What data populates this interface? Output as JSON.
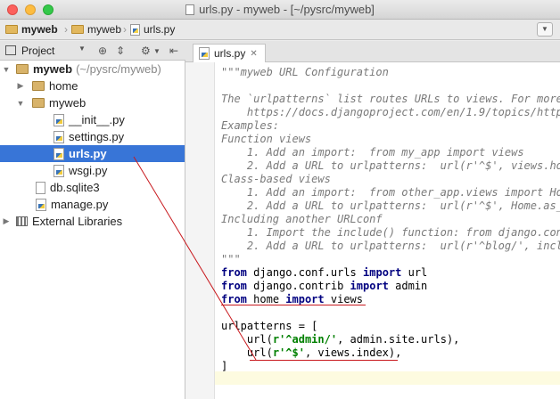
{
  "window": {
    "title": "urls.py - myweb - [~/pysrc/myweb]"
  },
  "breadcrumb": [
    "myweb",
    "myweb",
    "urls.py"
  ],
  "project_panel": {
    "label": "Project",
    "tree": [
      {
        "label": "myweb",
        "hint": "(~/pysrc/myweb)",
        "type": "folder",
        "expanded": true,
        "indent": 0
      },
      {
        "label": "home",
        "type": "folder",
        "expanded": false,
        "indent": 1
      },
      {
        "label": "myweb",
        "type": "folder",
        "expanded": true,
        "indent": 1
      },
      {
        "label": "__init__.py",
        "type": "py",
        "indent": 2
      },
      {
        "label": "settings.py",
        "type": "py",
        "indent": 2
      },
      {
        "label": "urls.py",
        "type": "py",
        "indent": 2,
        "selected": true
      },
      {
        "label": "wsgi.py",
        "type": "py",
        "indent": 2
      },
      {
        "label": "db.sqlite3",
        "type": "db",
        "indent": 1
      },
      {
        "label": "manage.py",
        "type": "py",
        "indent": 1
      },
      {
        "label": "External Libraries",
        "type": "lib",
        "expanded": false,
        "indent": 0
      }
    ]
  },
  "editor": {
    "tab_label": "urls.py",
    "lines": [
      "\"\"\"myweb URL Configuration",
      "",
      "The `urlpatterns` list routes URLs to views. For more i",
      "    https://docs.djangoproject.com/en/1.9/topics/http/",
      "Examples:",
      "Function views",
      "    1. Add an import:  from my_app import views",
      "    2. Add a URL to urlpatterns:  url(r'^$', views.home",
      "Class-based views",
      "    1. Add an import:  from other_app.views import Home",
      "    2. Add a URL to urlpatterns:  url(r'^$', Home.as_vi",
      "Including another URLconf",
      "    1. Import the include() function: from django.conf",
      "    2. Add a URL to urlpatterns:  url(r'^blog/', includ",
      "\"\"\"",
      "from django.conf.urls import url",
      "from django.contrib import admin",
      "from home import views",
      "",
      "urlpatterns = [",
      "    url(r'^admin/', admin.site.urls),",
      "    url(r'^$', views.index),",
      "]",
      ""
    ]
  },
  "colors": {
    "selection": "#3875d7",
    "keyword": "#000080",
    "string": "#008000",
    "docstring": "#7a7a7a",
    "annotation": "#c8191e"
  }
}
